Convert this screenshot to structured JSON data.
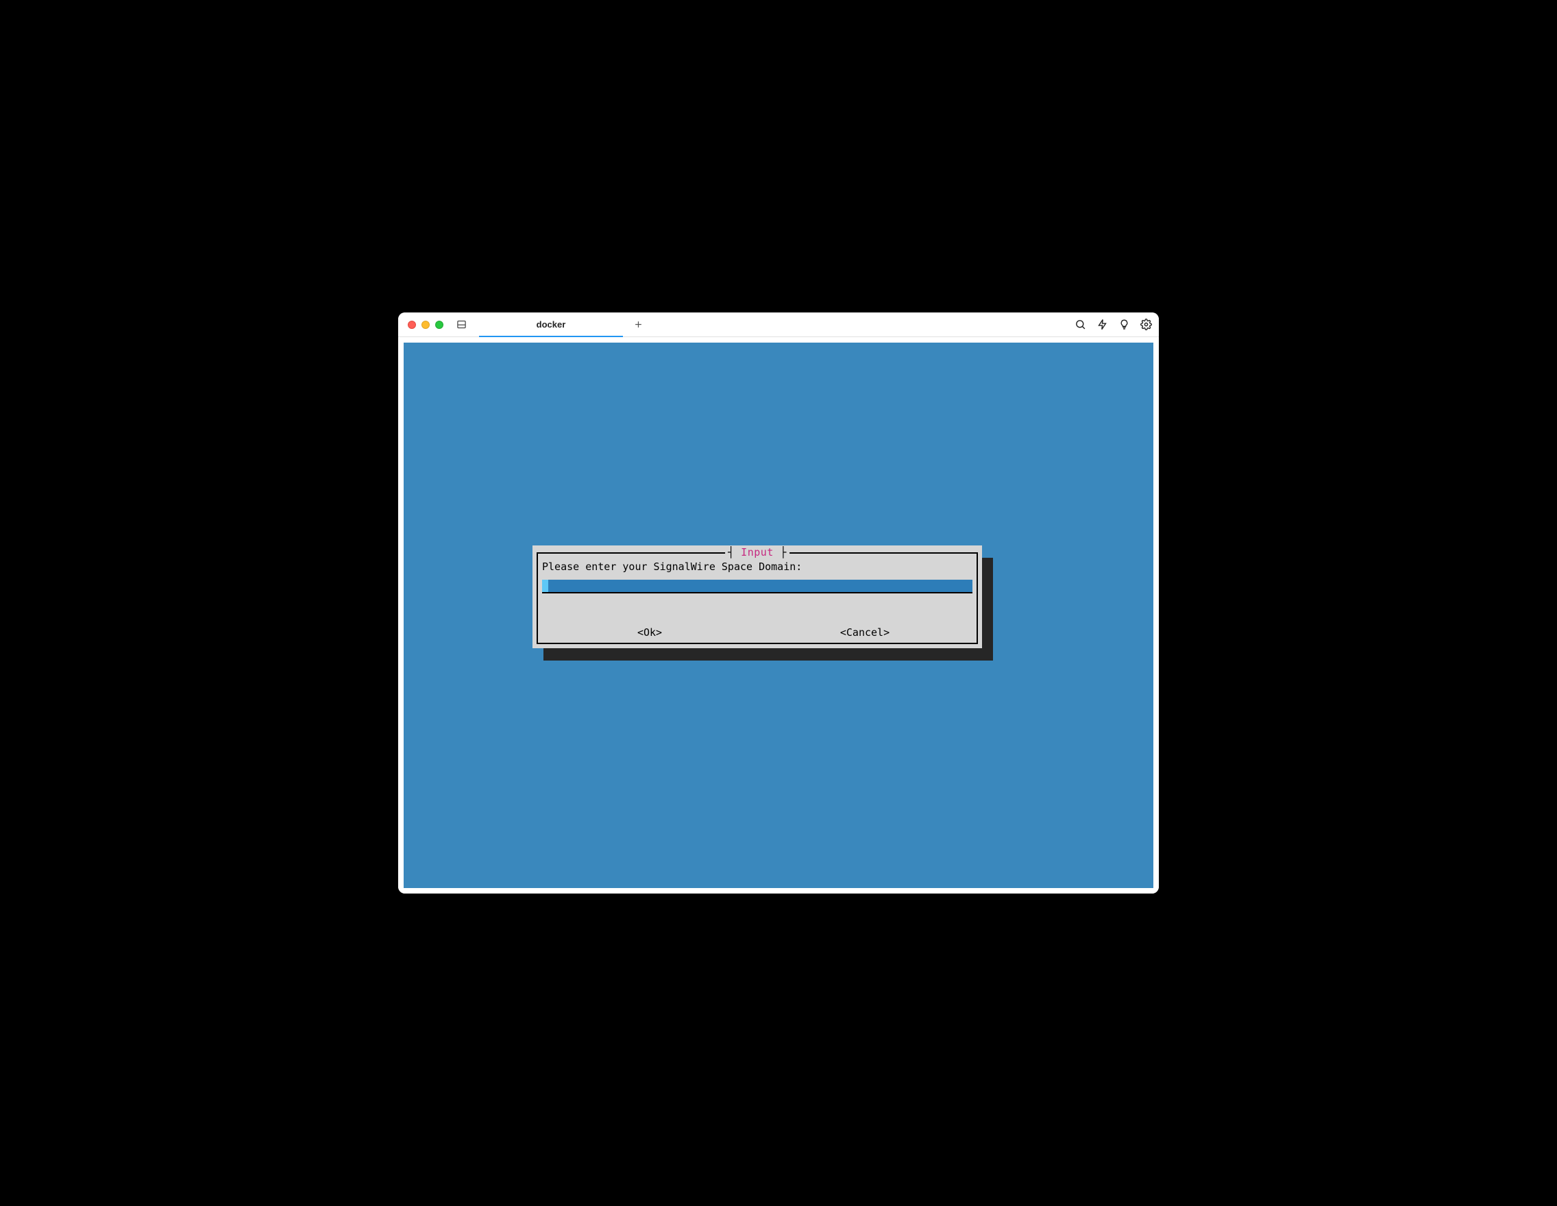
{
  "window": {
    "tab_title": "docker"
  },
  "dialog": {
    "title": "Input",
    "prompt": "Please enter your SignalWire Space Domain:",
    "input_value": "",
    "ok_label": "<Ok>",
    "cancel_label": "<Cancel>"
  }
}
